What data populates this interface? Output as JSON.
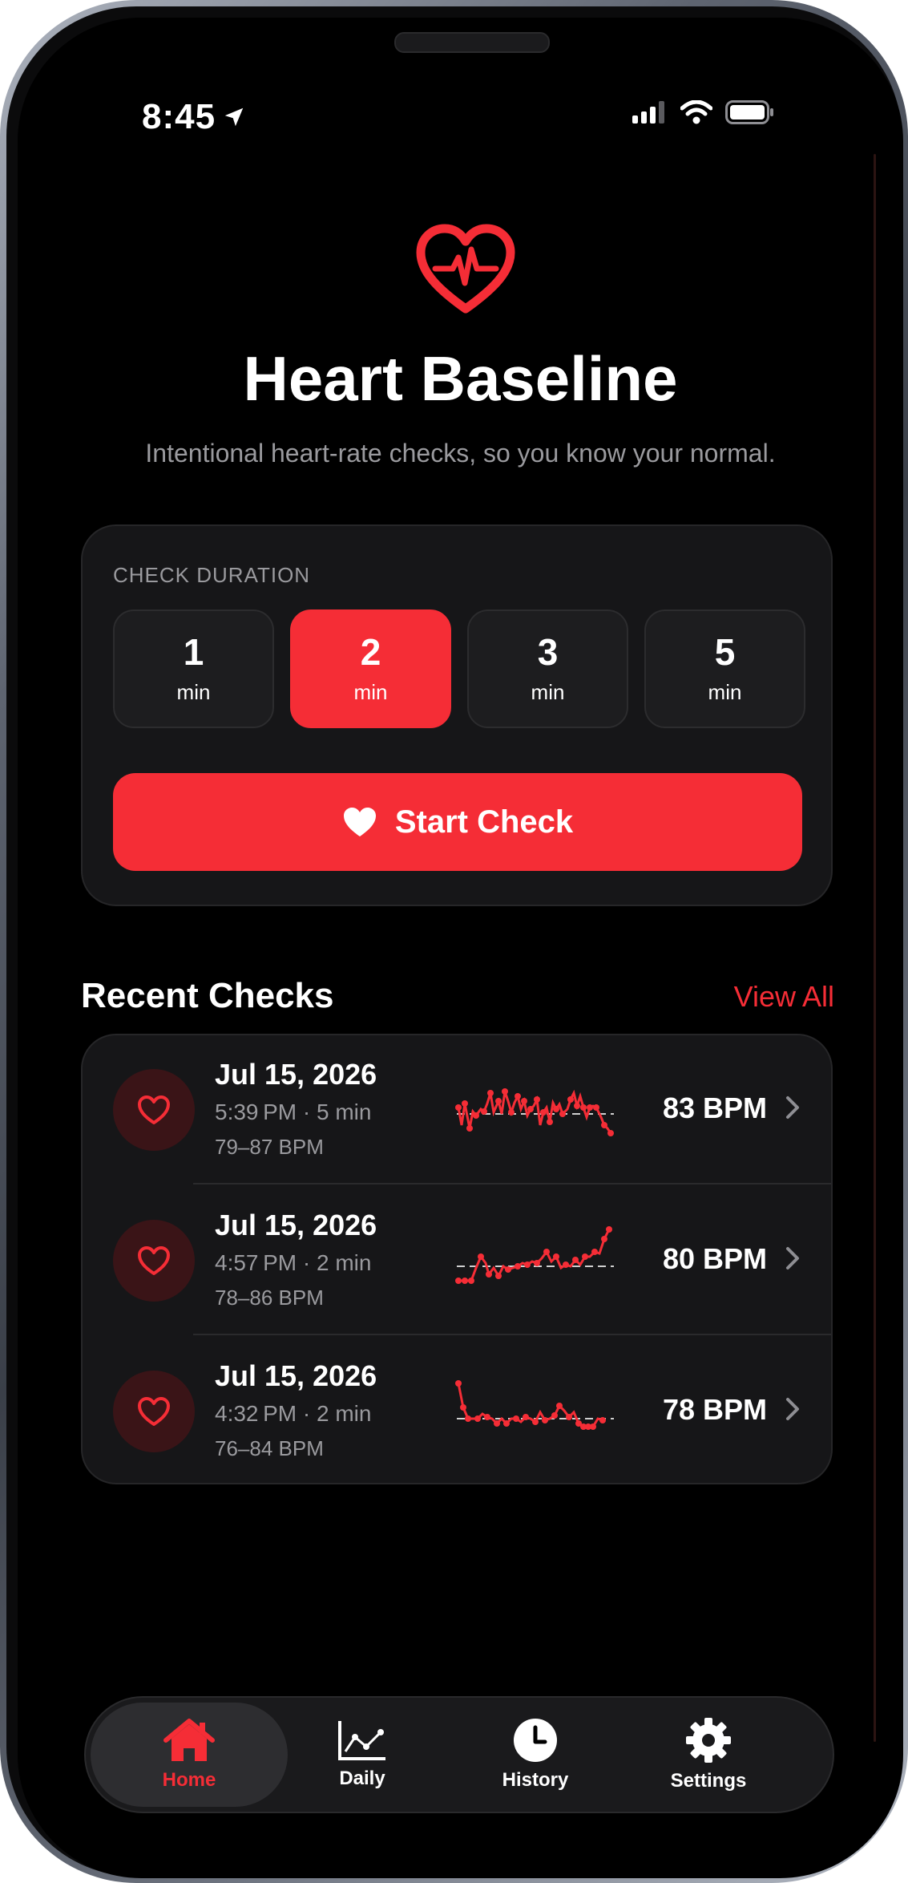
{
  "status": {
    "time": "8:45"
  },
  "header": {
    "title": "Heart Baseline",
    "subtitle": "Intentional heart-rate checks, so you know your normal."
  },
  "duration_card": {
    "label": "CHECK DURATION",
    "options": [
      {
        "value": "1",
        "unit": "min",
        "selected": false
      },
      {
        "value": "2",
        "unit": "min",
        "selected": true
      },
      {
        "value": "3",
        "unit": "min",
        "selected": false
      },
      {
        "value": "5",
        "unit": "min",
        "selected": false
      }
    ],
    "start_label": "Start Check"
  },
  "recent": {
    "title": "Recent Checks",
    "view_all": "View All",
    "items": [
      {
        "date": "Jul 15, 2026",
        "meta": "5:39 PM · 5 min",
        "range": "79–87 BPM",
        "bpm": "83 BPM",
        "icon": "heart-icon"
      },
      {
        "date": "Jul 15, 2026",
        "meta": "4:57 PM · 2 min",
        "range": "78–86 BPM",
        "bpm": "80 BPM",
        "icon": "heart-icon"
      },
      {
        "date": "Jul 15, 2026",
        "meta": "4:32 PM · 2 min",
        "range": "76–84 BPM",
        "bpm": "78 BPM",
        "icon": "heart-icon"
      }
    ]
  },
  "tabs": [
    {
      "label": "Home",
      "icon": "house-icon",
      "active": true
    },
    {
      "label": "Daily",
      "icon": "line-chart-icon",
      "active": false
    },
    {
      "label": "History",
      "icon": "clock-icon",
      "active": false
    },
    {
      "label": "Settings",
      "icon": "gear-icon",
      "active": false
    }
  ],
  "colors": {
    "accent": "#f52d36",
    "card": "#161618",
    "background": "#000000"
  }
}
